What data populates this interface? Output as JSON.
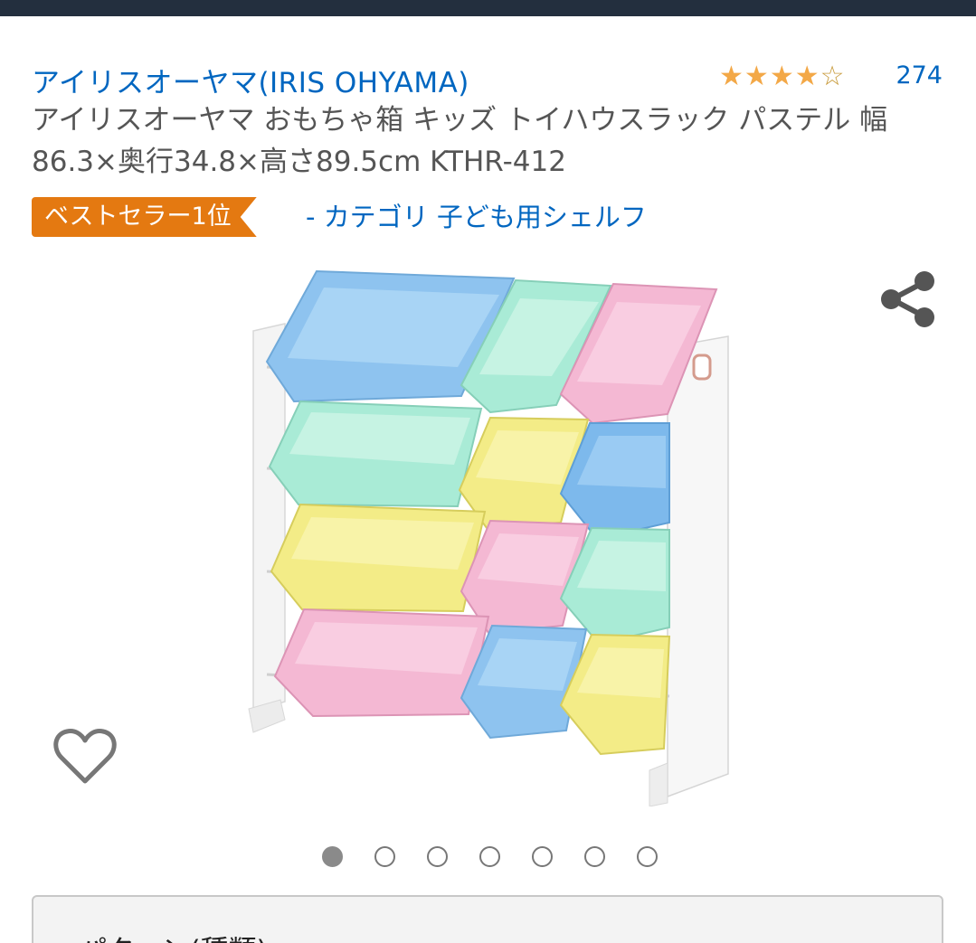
{
  "product": {
    "brand": "アイリスオーヤマ(IRIS OHYAMA)",
    "rating_value": 4,
    "rating_max": 5,
    "review_count": "274",
    "title": "アイリスオーヤマ おもちゃ箱 キッズ トイハウスラック パステル 幅86.3×奥行34.8×高さ89.5cm KTHR-412",
    "badge": "ベストセラー1位",
    "category": "- カテゴリ 子ども用シェルフ"
  },
  "carousel": {
    "image_count": 7,
    "active_index": 0
  },
  "variation": {
    "label": "パターン(種類)"
  },
  "icons": {
    "share": "share-icon",
    "favorite": "heart-icon"
  },
  "colors": {
    "link": "#0066c0",
    "badge": "#e47911",
    "star": "#f3a847",
    "top_bar": "#232f3e"
  }
}
